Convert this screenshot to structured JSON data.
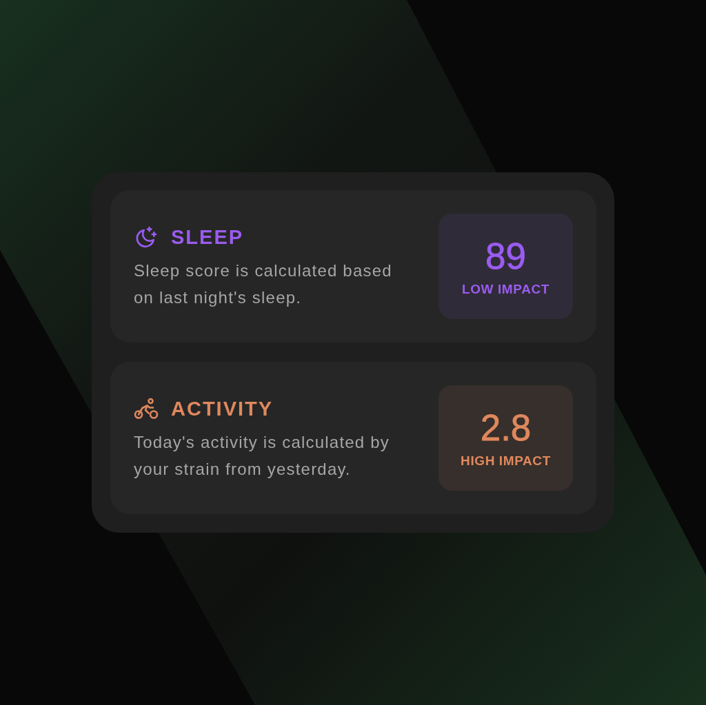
{
  "cards": [
    {
      "kind": "sleep",
      "title": "SLEEP",
      "color": "#9a5cf0",
      "description": "Sleep score is calculated based on last night's sleep.",
      "score": "89",
      "impact": "LOW IMPACT"
    },
    {
      "kind": "activity",
      "title": "ACTIVITY",
      "color": "#e0885e",
      "description": "Today's activity is calculated by your strain from yesterday.",
      "score": "2.8",
      "impact": "HIGH IMPACT"
    }
  ]
}
